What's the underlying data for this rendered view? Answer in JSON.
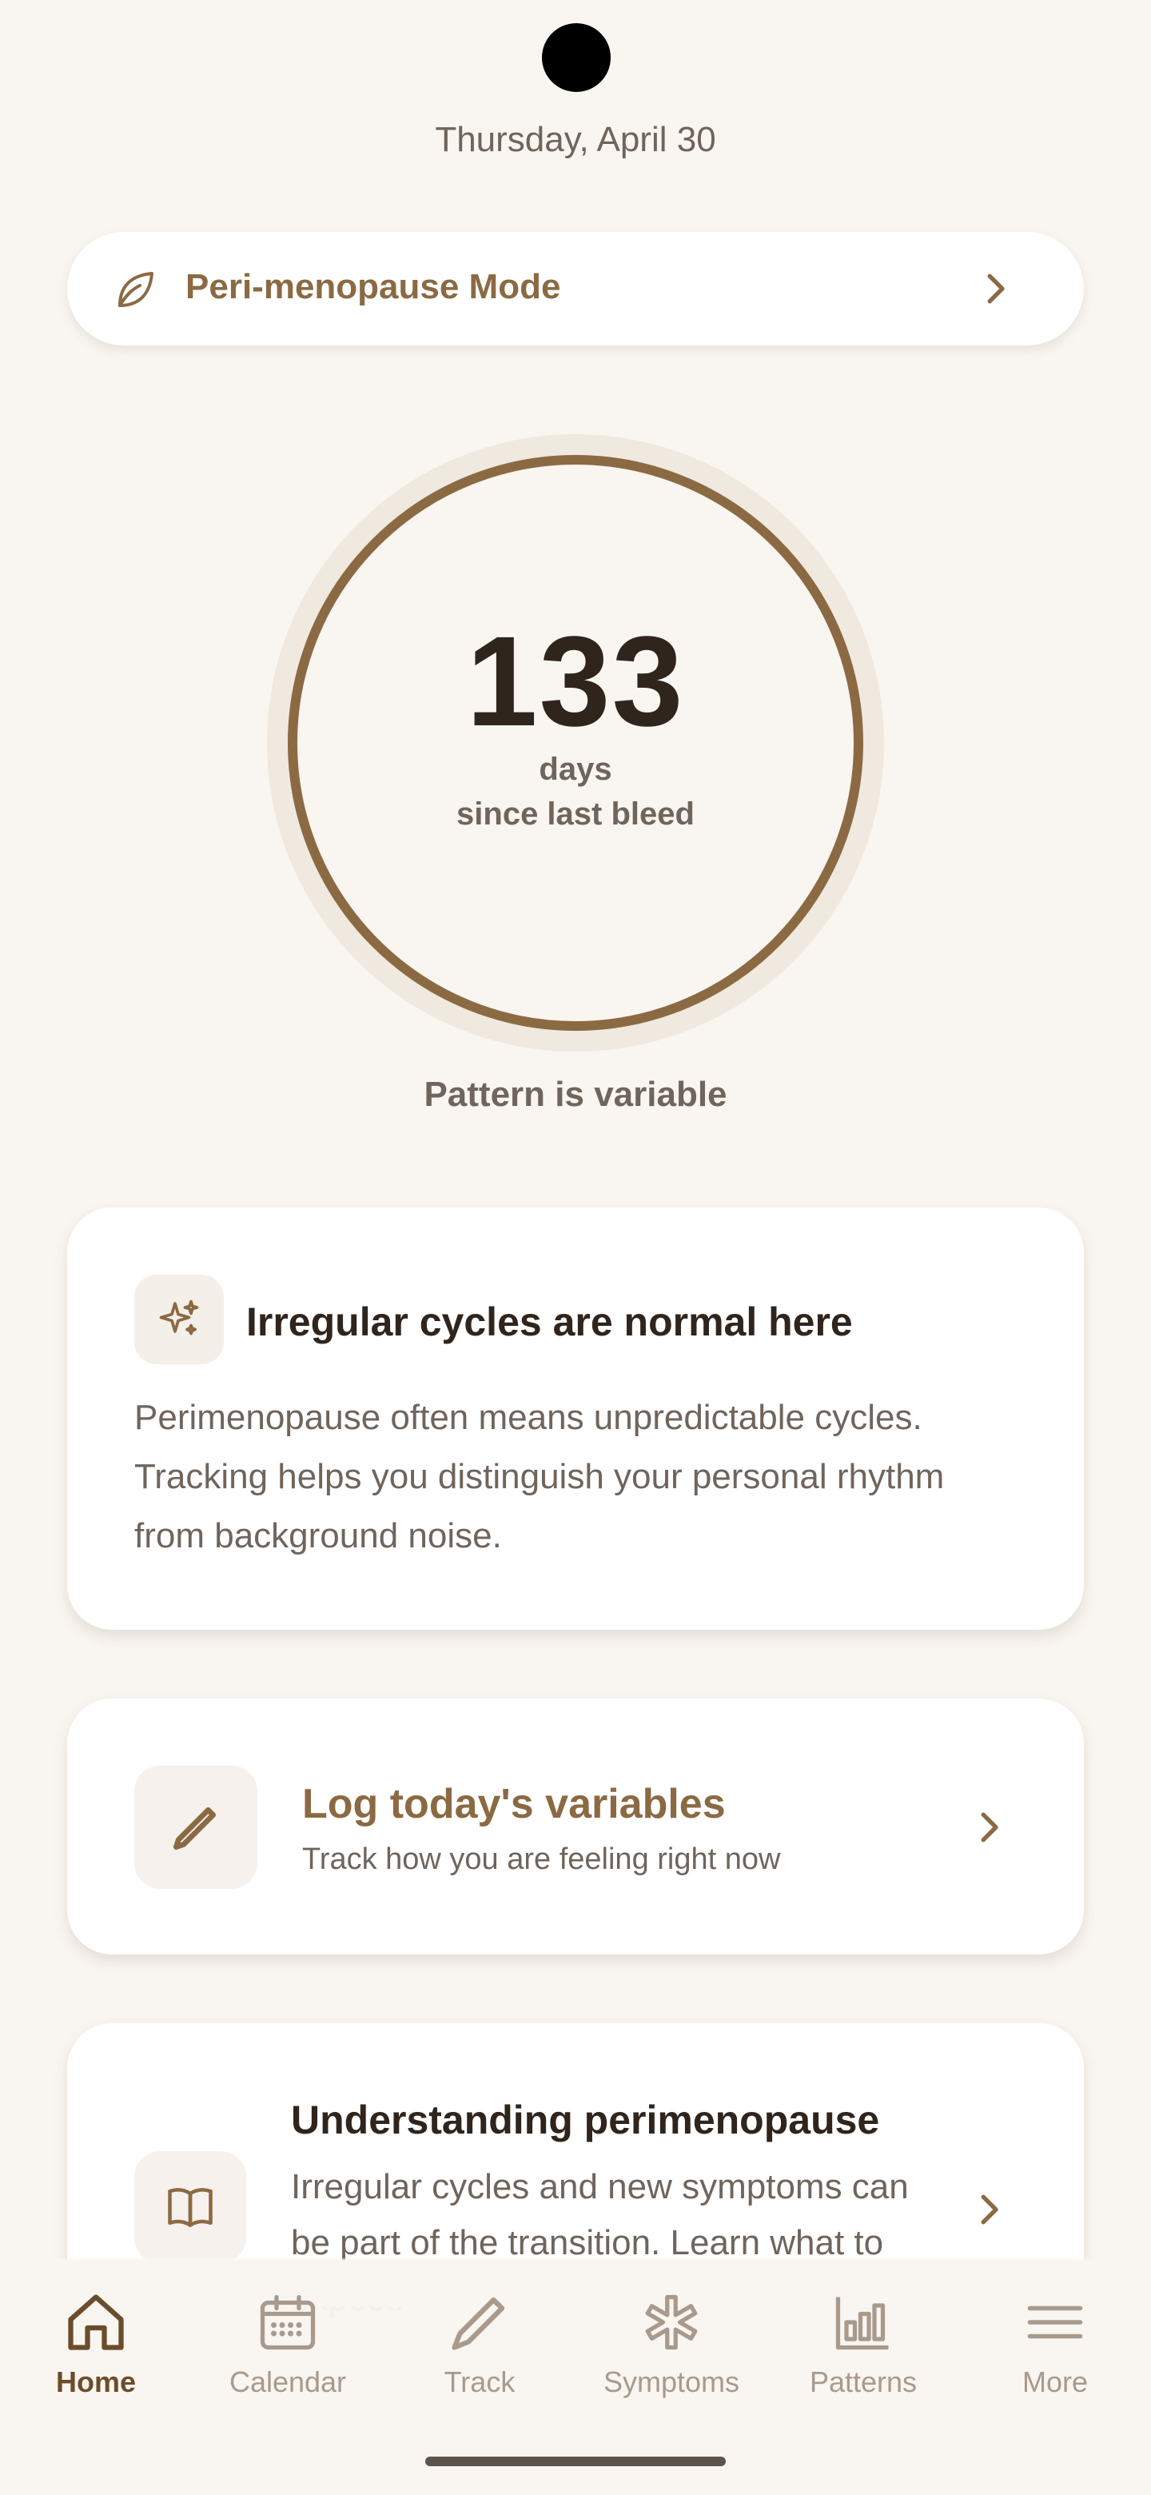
{
  "header": {
    "date": "Thursday, April 30"
  },
  "mode": {
    "label": "Peri-menopause Mode",
    "icon": "leaf-icon"
  },
  "cycle": {
    "days_count": "133",
    "days_label": "days",
    "since_label": "since last bleed",
    "pattern_status": "Pattern is variable"
  },
  "info_card": {
    "icon": "sparkle-icon",
    "title": "Irregular cycles are normal here",
    "body": "Perimenopause often means unpredictable cycles. Tracking helps you distinguish your personal rhythm from background noise."
  },
  "log_card": {
    "icon": "pencil-icon",
    "title": "Log today's variables",
    "subtitle": "Track how you are feeling right now"
  },
  "learn_card": {
    "icon": "book-icon",
    "title": "Understanding perimenopause",
    "body": "Irregular cycles and new symptoms can be part of the transition. Learn what to expect."
  },
  "tabs": [
    {
      "label": "Home",
      "icon": "home-icon",
      "active": true
    },
    {
      "label": "Calendar",
      "icon": "calendar-icon",
      "active": false
    },
    {
      "label": "Track",
      "icon": "pencil-icon",
      "active": false
    },
    {
      "label": "Symptoms",
      "icon": "asterisk-icon",
      "active": false
    },
    {
      "label": "Patterns",
      "icon": "bar-chart-icon",
      "active": false
    },
    {
      "label": "More",
      "icon": "menu-icon",
      "active": false
    }
  ],
  "colors": {
    "background": "#f9f5f0",
    "accent": "#8b6a43",
    "active_tab": "#6b4d2b",
    "inactive_tab": "#a89a8c",
    "text_primary": "#2f251d",
    "text_secondary": "#6f655c"
  }
}
